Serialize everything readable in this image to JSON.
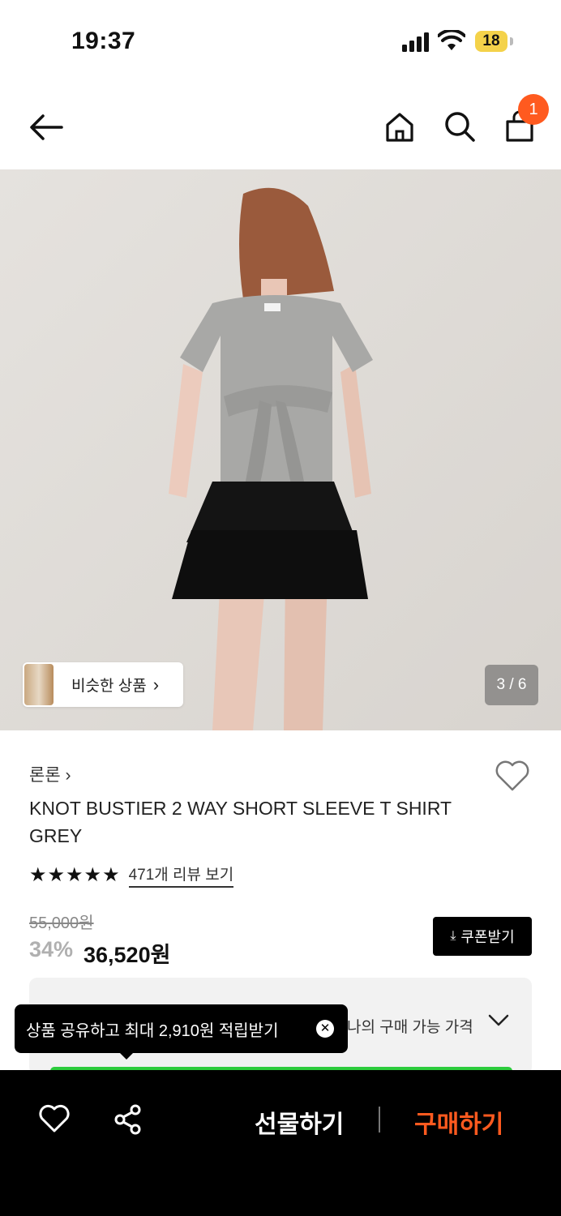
{
  "status_bar": {
    "time": "19:37",
    "battery": "18"
  },
  "header": {
    "cart_count": "1"
  },
  "gallery": {
    "similar_label": "비슷한 상품",
    "chevron": "›",
    "pager": "3 / 6"
  },
  "product": {
    "brand": "론론 ›",
    "title": "KNOT BUSTIER 2 WAY SHORT SLEEVE T SHIRT GREY",
    "stars": "★★★★★",
    "rating": 4.5,
    "review_link": "471개 리뷰 보기",
    "original_price": "55,000원",
    "discount": "34%",
    "price": "36,520원",
    "coupon_label": "쿠폰받기",
    "my_price_label": "나의 구매 가능 가격"
  },
  "tooltip": {
    "text": "상품 공유하고 최대 2,910원 적립받기",
    "close": "✕"
  },
  "bottom_bar": {
    "gift_label": "선물하기",
    "buy_label": "구매하기"
  },
  "colors": {
    "accent": "#ff5a1f",
    "green": "#2dcc3d",
    "bg_hero": "#dfdcd8"
  }
}
